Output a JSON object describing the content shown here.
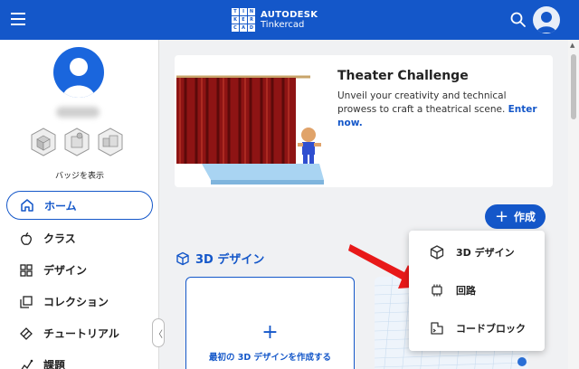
{
  "topbar": {
    "logo_tiles": [
      "T",
      "I",
      "N",
      "K",
      "E",
      "R",
      "C",
      "A",
      "D"
    ],
    "brand_line1": "AUTODESK",
    "brand_line2": "Tinkercad",
    "bg_color": "#1457c9"
  },
  "sidebar": {
    "badges_label": "バッジを表示",
    "nav": [
      {
        "label": "ホーム",
        "icon": "home-icon",
        "active": true
      },
      {
        "label": "クラス",
        "icon": "apple-icon"
      },
      {
        "label": "デザイン",
        "icon": "grid-icon"
      },
      {
        "label": "コレクション",
        "icon": "collection-icon"
      },
      {
        "label": "チュートリアル",
        "icon": "tutorial-icon"
      },
      {
        "label": "課題",
        "icon": "assignment-icon"
      }
    ],
    "collapse_glyph": "〈"
  },
  "promo": {
    "title": "Theater Challenge",
    "description": "Unveil your creativity and technical prowess to craft a theatrical scene.",
    "link": "Enter now."
  },
  "create_button": {
    "plus": "+",
    "label": "作成"
  },
  "section": {
    "title": "3D デザイン"
  },
  "new_design": {
    "plus": "+",
    "label": "最初の 3D デザインを作成する"
  },
  "dropdown": [
    {
      "label": "3D デザイン",
      "icon": "cube-icon"
    },
    {
      "label": "回路",
      "icon": "chip-icon"
    },
    {
      "label": "コードブロック",
      "icon": "codeblocks-icon"
    }
  ],
  "colors": {
    "accent": "#1457c9",
    "arrow": "#e81919"
  }
}
